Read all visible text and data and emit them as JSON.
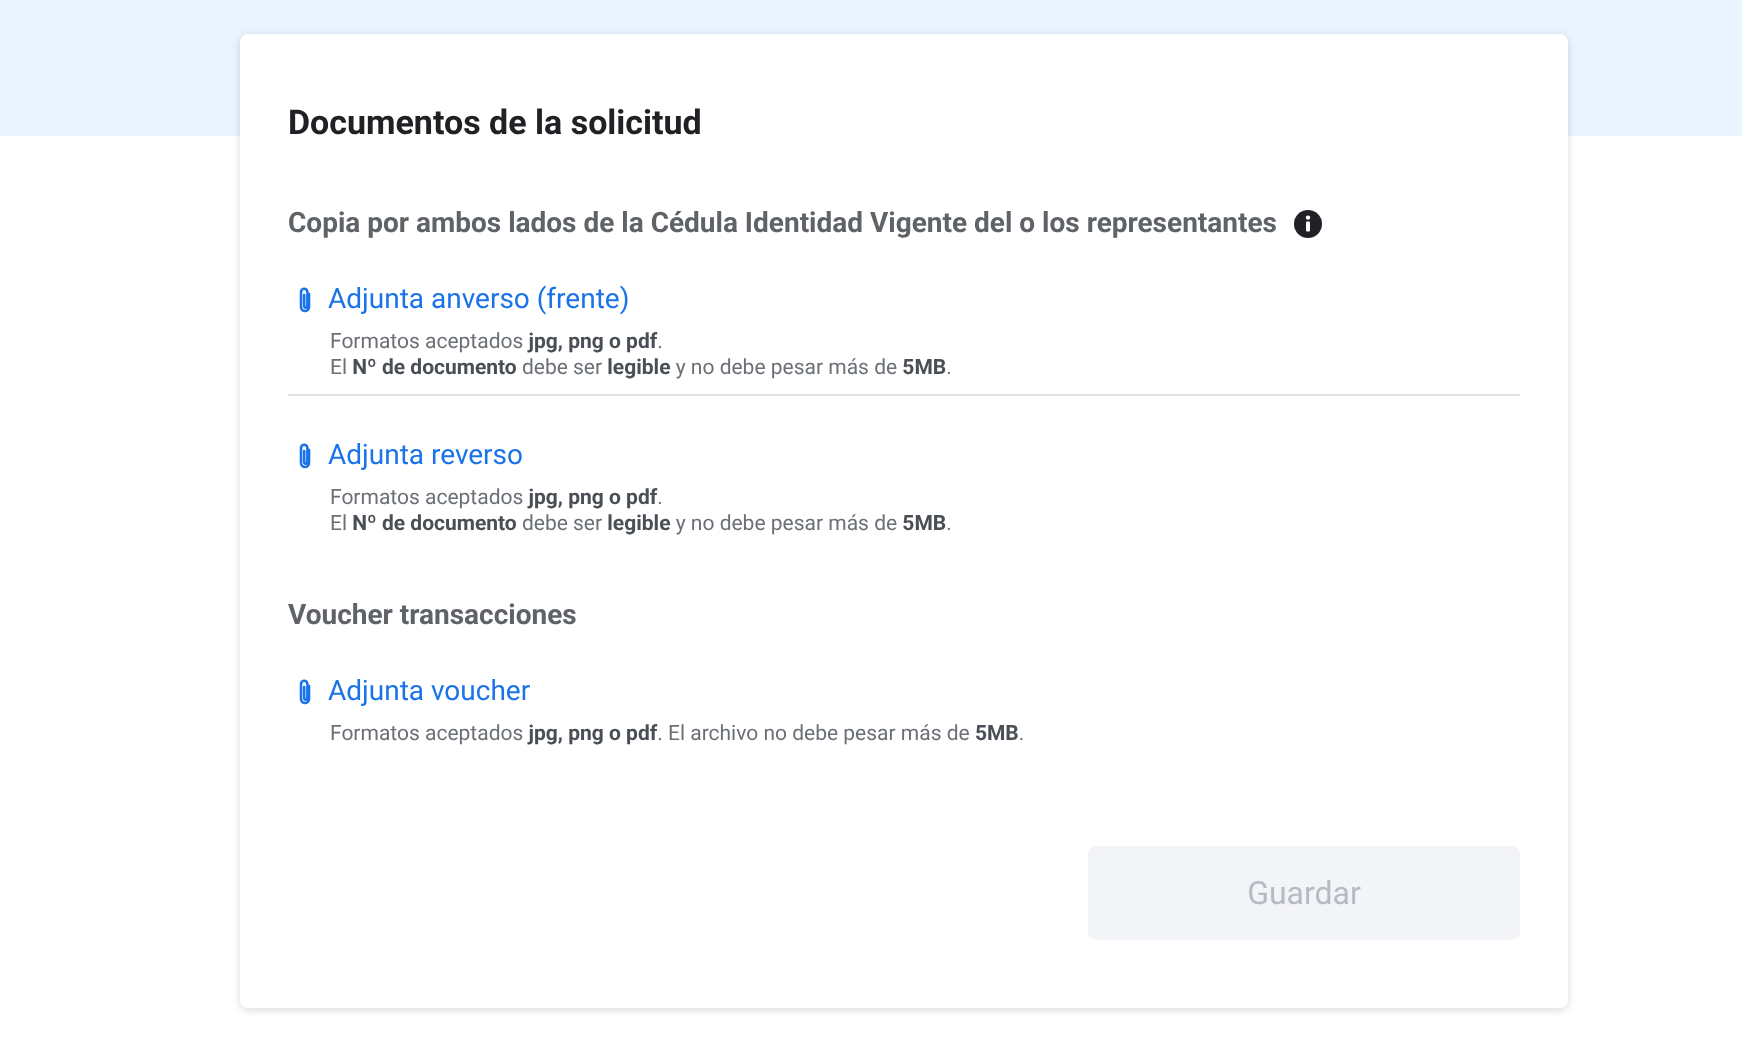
{
  "title": "Documentos de la solicitud",
  "sections": [
    {
      "heading": "Copia por ambos lados de la Cédula Identidad Vigente del o los representantes",
      "info": true,
      "uploads": [
        {
          "label": "Adjunta anverso (frente)",
          "hints": [
            "Formatos aceptados **jpg, png o pdf**.",
            "El **Nº de documento** debe ser **legible** y no debe pesar más de **5MB**."
          ]
        },
        {
          "label": "Adjunta reverso",
          "hints": [
            "Formatos aceptados **jpg, png o pdf**.",
            "El **Nº de documento** debe ser **legible** y no debe pesar más de **5MB**."
          ]
        }
      ]
    },
    {
      "heading": "Voucher transacciones",
      "info": false,
      "uploads": [
        {
          "label": "Adjunta voucher",
          "hints": [
            "Formatos aceptados **jpg, png o pdf**. El archivo no debe pesar más de **5MB**."
          ]
        }
      ]
    }
  ],
  "button": {
    "label": "Guardar",
    "disabled": true
  }
}
